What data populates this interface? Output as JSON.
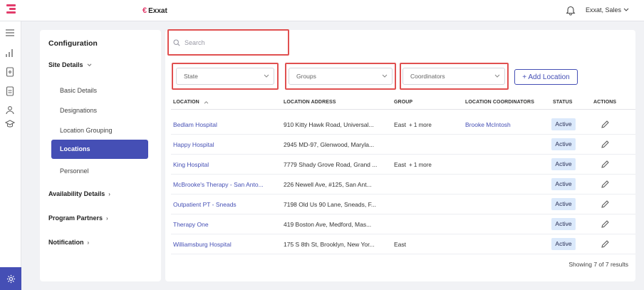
{
  "topbar": {
    "brand": "Exxat",
    "user": "Exxat, Sales"
  },
  "config": {
    "title": "Configuration",
    "site_details": "Site Details",
    "items": [
      "Basic Details",
      "Designations",
      "Location Grouping",
      "Locations",
      "Personnel"
    ],
    "availability": "Availability Details",
    "partners": "Program Partners",
    "notification": "Notification"
  },
  "filters": {
    "search_placeholder": "Search",
    "state": "State",
    "groups": "Groups",
    "coordinators": "Coordinators",
    "add_location": "+ Add Location"
  },
  "table": {
    "headers": {
      "location": "LOCATION",
      "address": "LOCATION ADDRESS",
      "group": "GROUP",
      "coordinators": "LOCATION COORDINATORS",
      "status": "STATUS",
      "actions": "ACTIONS"
    },
    "rows": [
      {
        "location": "Bedlam Hospital",
        "address": "910 Kitty Hawk Road, Universal...",
        "group": "East",
        "more": "+ 1 more",
        "coordinator": "Brooke McIntosh",
        "status": "Active"
      },
      {
        "location": "Happy Hospital",
        "address": "2945 MD-97, Glenwood, Maryla...",
        "group": "",
        "more": "",
        "coordinator": "",
        "status": "Active"
      },
      {
        "location": "King Hospital",
        "address": "7779 Shady Grove Road, Grand ...",
        "group": "East",
        "more": "+ 1 more",
        "coordinator": "",
        "status": "Active"
      },
      {
        "location": "McBrooke's Therapy - San Anto...",
        "address": "226 Newell Ave, #125, San Ant...",
        "group": "",
        "more": "",
        "coordinator": "",
        "status": "Active"
      },
      {
        "location": "Outpatient PT - Sneads",
        "address": "7198 Old Us 90 Lane, Sneads, F...",
        "group": "",
        "more": "",
        "coordinator": "",
        "status": "Active"
      },
      {
        "location": "Therapy One",
        "address": "419 Boston Ave, Medford, Mas...",
        "group": "",
        "more": "",
        "coordinator": "",
        "status": "Active"
      },
      {
        "location": "Williamsburg Hospital",
        "address": "175 S 8th St, Brooklyn, New Yor...",
        "group": "East",
        "more": "",
        "coordinator": "",
        "status": "Active"
      }
    ],
    "footer": "Showing 7 of 7 results"
  }
}
